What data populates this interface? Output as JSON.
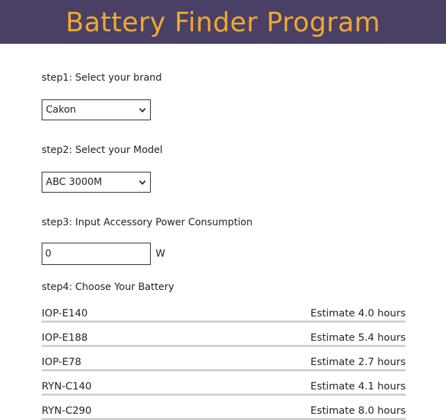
{
  "header": {
    "title": "Battery Finder Program"
  },
  "steps": {
    "brand": {
      "label": "step1: Select your brand",
      "selected": "Cakon"
    },
    "model": {
      "label": "step2: Select your Model",
      "selected": "ABC 3000M"
    },
    "power": {
      "label": "step3: Input Accessory Power Consumption",
      "value": "0",
      "unit": "W"
    },
    "battery": {
      "label": "step4: Choose Your Battery"
    }
  },
  "batteries": [
    {
      "name": "IOP-E140",
      "estimate": "Estimate 4.0 hours"
    },
    {
      "name": "IOP-E188",
      "estimate": "Estimate 5.4 hours"
    },
    {
      "name": "IOP-E78",
      "estimate": "Estimate 2.7 hours"
    },
    {
      "name": "RYN-C140",
      "estimate": "Estimate 4.1 hours"
    },
    {
      "name": "RYN-C290",
      "estimate": "Estimate 8.0 hours"
    }
  ],
  "colors": {
    "header_bg": "#4a4066",
    "header_text": "#f0a830",
    "row_divider": "#cfcfcf"
  },
  "icons": {
    "dropdown": "chevron-down-icon"
  }
}
